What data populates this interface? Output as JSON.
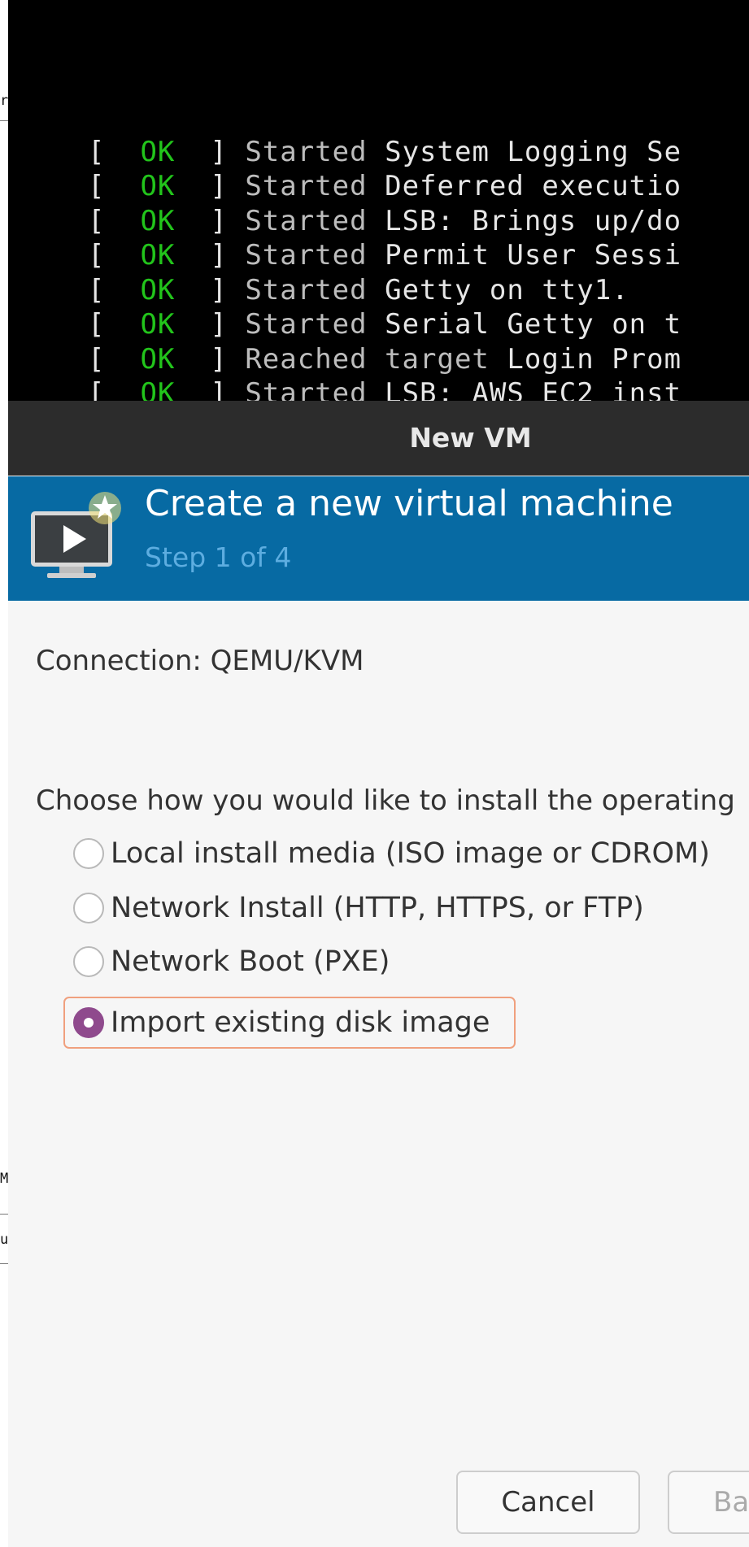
{
  "background_app": {
    "fragments": [
      "r",
      "M",
      "u"
    ]
  },
  "console": {
    "lines": [
      {
        "bracket_open": "[",
        "status": "OK",
        "bracket_close": "]",
        "verb": "Started",
        "text": "System Logging Se"
      },
      {
        "bracket_open": "[",
        "status": "OK",
        "bracket_close": "]",
        "verb": "Started",
        "text": "Deferred executio"
      },
      {
        "bracket_open": "[",
        "status": "OK",
        "bracket_close": "]",
        "verb": "Started",
        "text": "LSB: Brings up/do"
      },
      {
        "bracket_open": "[",
        "status": "OK",
        "bracket_close": "]",
        "verb": "Started",
        "text": "Permit User Sessi"
      },
      {
        "bracket_open": "[",
        "status": "OK",
        "bracket_close": "]",
        "verb": "Started",
        "text": "Getty on tty1."
      },
      {
        "bracket_open": "[",
        "status": "OK",
        "bracket_close": "]",
        "verb": "Started",
        "text": "Serial Getty on t"
      },
      {
        "bracket_open": "[",
        "status": "OK",
        "bracket_close": "]",
        "verb": "Reached target",
        "text": "Login Prom"
      },
      {
        "bracket_open": "[",
        "status": "OK",
        "bracket_close": "]",
        "verb": "Started",
        "text": "LSB: AWS EC2 inst"
      }
    ]
  },
  "dialog": {
    "window_title": "New VM",
    "banner": {
      "title": "Create a new virtual machine",
      "step": "Step 1 of 4",
      "icon": "vm-create-icon"
    },
    "connection_label": "Connection:  QEMU/KVM",
    "choose_prompt": "Choose how you would like to install the operating",
    "options": [
      {
        "label": "Local install media (ISO image or CDROM)",
        "selected": false
      },
      {
        "label": "Network Install (HTTP, HTTPS, or FTP)",
        "selected": false
      },
      {
        "label": "Network Boot (PXE)",
        "selected": false
      },
      {
        "label": "Import existing disk image",
        "selected": true
      }
    ],
    "buttons": {
      "cancel": "Cancel",
      "back": "Ba"
    }
  },
  "colors": {
    "banner": "#076aa3",
    "titlebar": "#2c2c2c",
    "radio_selected": "#8f4a8d",
    "focus_ring": "#f0a07e",
    "console_ok": "#22c41b"
  }
}
